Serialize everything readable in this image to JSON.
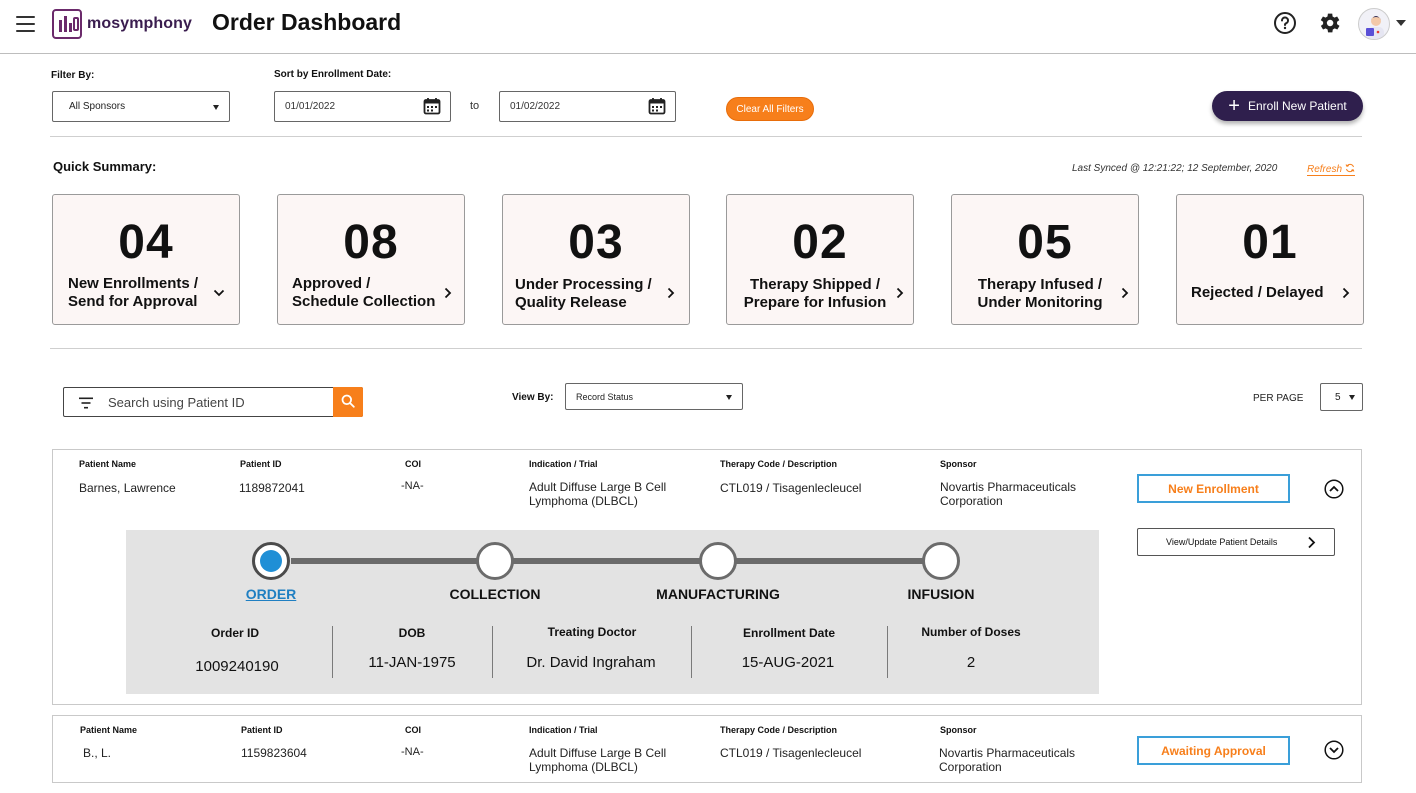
{
  "header": {
    "brand": "mosymphony",
    "page_title": "Order Dashboard"
  },
  "filters": {
    "filter_by_label": "Filter By:",
    "sponsor_select_value": "All Sponsors",
    "sort_label": "Sort by Enrollment Date:",
    "date_from": "01/01/2022",
    "to_label": "to",
    "date_to": "01/02/2022",
    "clear_label": "Clear All Filters",
    "enroll_label": "Enroll New Patient"
  },
  "summary": {
    "title": "Quick Summary:",
    "synced_text": "Last Synced @ 12:21:22; 12 September, 2020",
    "refresh_label": "Refresh",
    "cards": [
      {
        "count": "04",
        "line1": "New Enrollments /",
        "line2": "Send for Approval",
        "chevron": "chevron-down-icon"
      },
      {
        "count": "08",
        "line1": "Approved /",
        "line2": "Schedule Collection",
        "chevron": "chevron-right-icon"
      },
      {
        "count": "03",
        "line1": "Under Processing /",
        "line2": "Quality Release",
        "chevron": "chevron-right-icon"
      },
      {
        "count": "02",
        "line1": "Therapy Shipped /",
        "line2": "Prepare for Infusion",
        "chevron": "chevron-right-icon"
      },
      {
        "count": "05",
        "line1": "Therapy Infused /",
        "line2": "Under Monitoring",
        "chevron": "chevron-right-icon"
      },
      {
        "count": "01",
        "line1": "Rejected / Delayed",
        "line2": "",
        "chevron": "chevron-right-icon"
      }
    ]
  },
  "search": {
    "placeholder": "Search using Patient ID",
    "view_by_label": "View By:",
    "view_by_value": "Record Status",
    "per_page_label": "PER PAGE",
    "per_page_value": "5"
  },
  "columns": {
    "patient_name": "Patient Name",
    "patient_id": "Patient ID",
    "coi": "COI",
    "indication": "Indication / Trial",
    "therapy": "Therapy Code / Description",
    "sponsor": "Sponsor"
  },
  "patients": [
    {
      "name": "Barnes, Lawrence",
      "id": "1189872041",
      "coi": "-NA-",
      "indication_l1": "Adult Diffuse Large B Cell",
      "indication_l2": "Lymphoma (DLBCL)",
      "therapy": "CTL019 / Tisagenlecleucel",
      "sponsor_l1": "Novartis Pharmaceuticals",
      "sponsor_l2": "Corporation",
      "status": "New Enrollment",
      "view_details_label": "View/Update Patient Details",
      "steps": [
        "ORDER",
        "COLLECTION",
        "MANUFACTURING",
        "INFUSION"
      ],
      "active_step": "ORDER",
      "details": {
        "order_id_label": "Order ID",
        "order_id": "1009240190",
        "dob_label": "DOB",
        "dob": "11-JAN-1975",
        "doctor_label": "Treating Doctor",
        "doctor": "Dr. David Ingraham",
        "enroll_label": "Enrollment Date",
        "enroll_date": "15-AUG-2021",
        "doses_label": "Number of Doses",
        "doses": "2"
      }
    },
    {
      "name": "B., L.",
      "id": "1159823604",
      "coi": "-NA-",
      "indication_l1": "Adult Diffuse Large B Cell",
      "indication_l2": "Lymphoma (DLBCL)",
      "therapy": "CTL019 / Tisagenlecleucel",
      "sponsor_l1": "Novartis Pharmaceuticals",
      "sponsor_l2": "Corporation",
      "status": "Awaiting Approval"
    }
  ],
  "colors": {
    "accent_orange": "#f77f1b",
    "brand_dark": "#2f1f4d",
    "status_border": "#3a9fd9",
    "active_step": "#1f8fd6"
  }
}
